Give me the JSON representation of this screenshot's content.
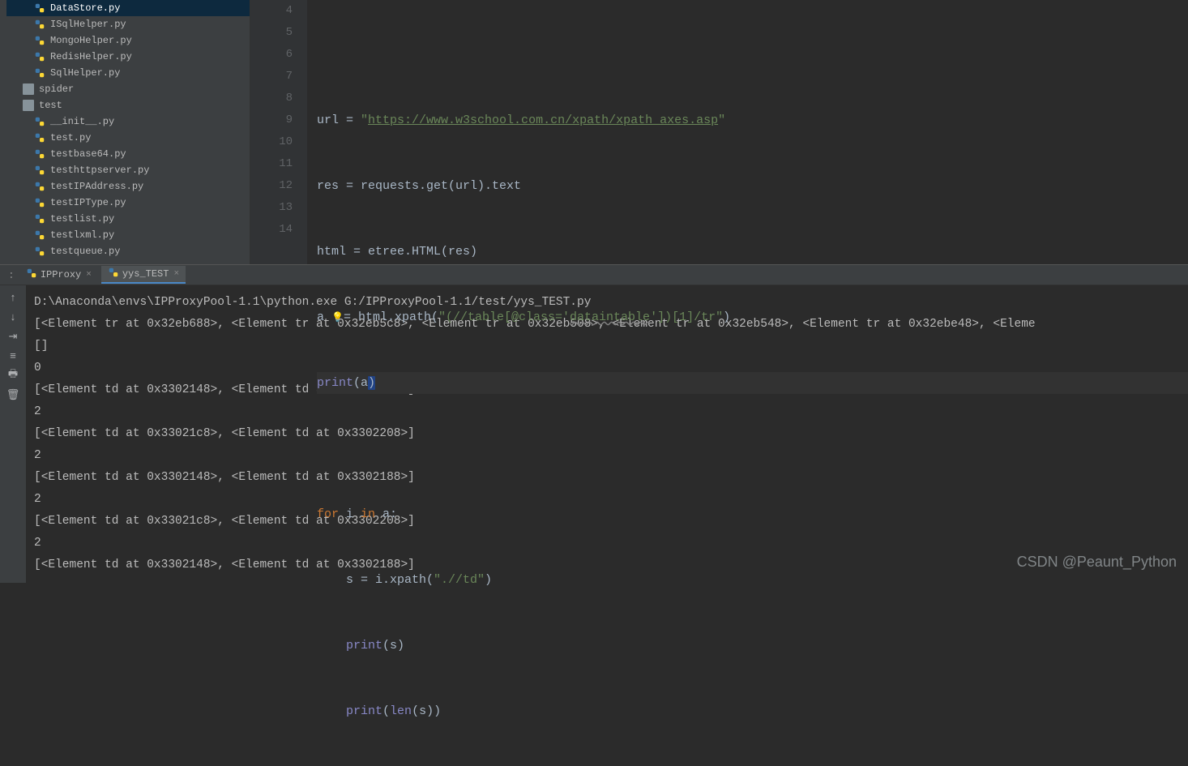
{
  "sidebar": {
    "items": [
      {
        "name": "DataStore.py",
        "indent": 2,
        "type": "py",
        "selected": true
      },
      {
        "name": "ISqlHelper.py",
        "indent": 2,
        "type": "py"
      },
      {
        "name": "MongoHelper.py",
        "indent": 2,
        "type": "py"
      },
      {
        "name": "RedisHelper.py",
        "indent": 2,
        "type": "py"
      },
      {
        "name": "SqlHelper.py",
        "indent": 2,
        "type": "py"
      },
      {
        "name": "spider",
        "indent": 1,
        "type": "folder"
      },
      {
        "name": "test",
        "indent": 1,
        "type": "folder"
      },
      {
        "name": "__init__.py",
        "indent": 2,
        "type": "py"
      },
      {
        "name": "test.py",
        "indent": 2,
        "type": "py"
      },
      {
        "name": "testbase64.py",
        "indent": 2,
        "type": "py"
      },
      {
        "name": "testhttpserver.py",
        "indent": 2,
        "type": "py"
      },
      {
        "name": "testIPAddress.py",
        "indent": 2,
        "type": "py"
      },
      {
        "name": "testIPType.py",
        "indent": 2,
        "type": "py"
      },
      {
        "name": "testlist.py",
        "indent": 2,
        "type": "py"
      },
      {
        "name": "testlxml.py",
        "indent": 2,
        "type": "py"
      },
      {
        "name": "testqueue.py",
        "indent": 2,
        "type": "py"
      }
    ]
  },
  "editor": {
    "line_numbers": [
      "4",
      "5",
      "6",
      "7",
      "8",
      "9",
      "10",
      "11",
      "12",
      "13",
      "14"
    ],
    "code": {
      "l4": "",
      "l5_pre": "url = ",
      "l5_q": "\"",
      "l5_url": "https://www.w3school.com.cn/xpath/xpath_axes.asp",
      "l6": "res = requests.get(url).text",
      "l7": "html = etree.HTML(res)",
      "l8_pre": "a ",
      "l8_mid": "= html.xpath(",
      "l8_q": "\"",
      "l8_s1": "(//table[@class='",
      "l8_s2": "dataintable",
      "l8_s3": "'])[1]/tr",
      "l8_end": ")",
      "l9_fn": "print",
      "l9_p": "(a)",
      "l11_for": "for",
      "l11_a": " i ",
      "l11_in": "in",
      "l11_b": " a:",
      "l12_pre": "    s = i.xpath(",
      "l12_s": "\".//td\"",
      "l12_end": ")",
      "l13_pre": "    ",
      "l13_fn": "print",
      "l13_p": "(s)",
      "l14_pre": "    ",
      "l14_fn": "print",
      "l14_p1": "(",
      "l14_len": "len",
      "l14_p2": "(s))"
    }
  },
  "run": {
    "tabs": [
      {
        "label": "IPProxy",
        "active": false
      },
      {
        "label": "yys_TEST",
        "active": true
      }
    ]
  },
  "console": {
    "lines": [
      "D:\\Anaconda\\envs\\IPProxyPool-1.1\\python.exe G:/IPProxyPool-1.1/test/yys_TEST.py",
      "[<Element tr at 0x32eb688>, <Element tr at 0x32eb5c8>, <Element tr at 0x32eb508>, <Element tr at 0x32eb548>, <Element tr at 0x32ebe48>, <Eleme",
      "[]",
      "0",
      "[<Element td at 0x3302148>, <Element td at 0x3302188>]",
      "2",
      "[<Element td at 0x33021c8>, <Element td at 0x3302208>]",
      "2",
      "[<Element td at 0x3302148>, <Element td at 0x3302188>]",
      "2",
      "[<Element td at 0x33021c8>, <Element td at 0x3302208>]",
      "2",
      "[<Element td at 0x3302148>, <Element td at 0x3302188>]"
    ]
  },
  "watermark": "CSDN @Peaunt_Python"
}
